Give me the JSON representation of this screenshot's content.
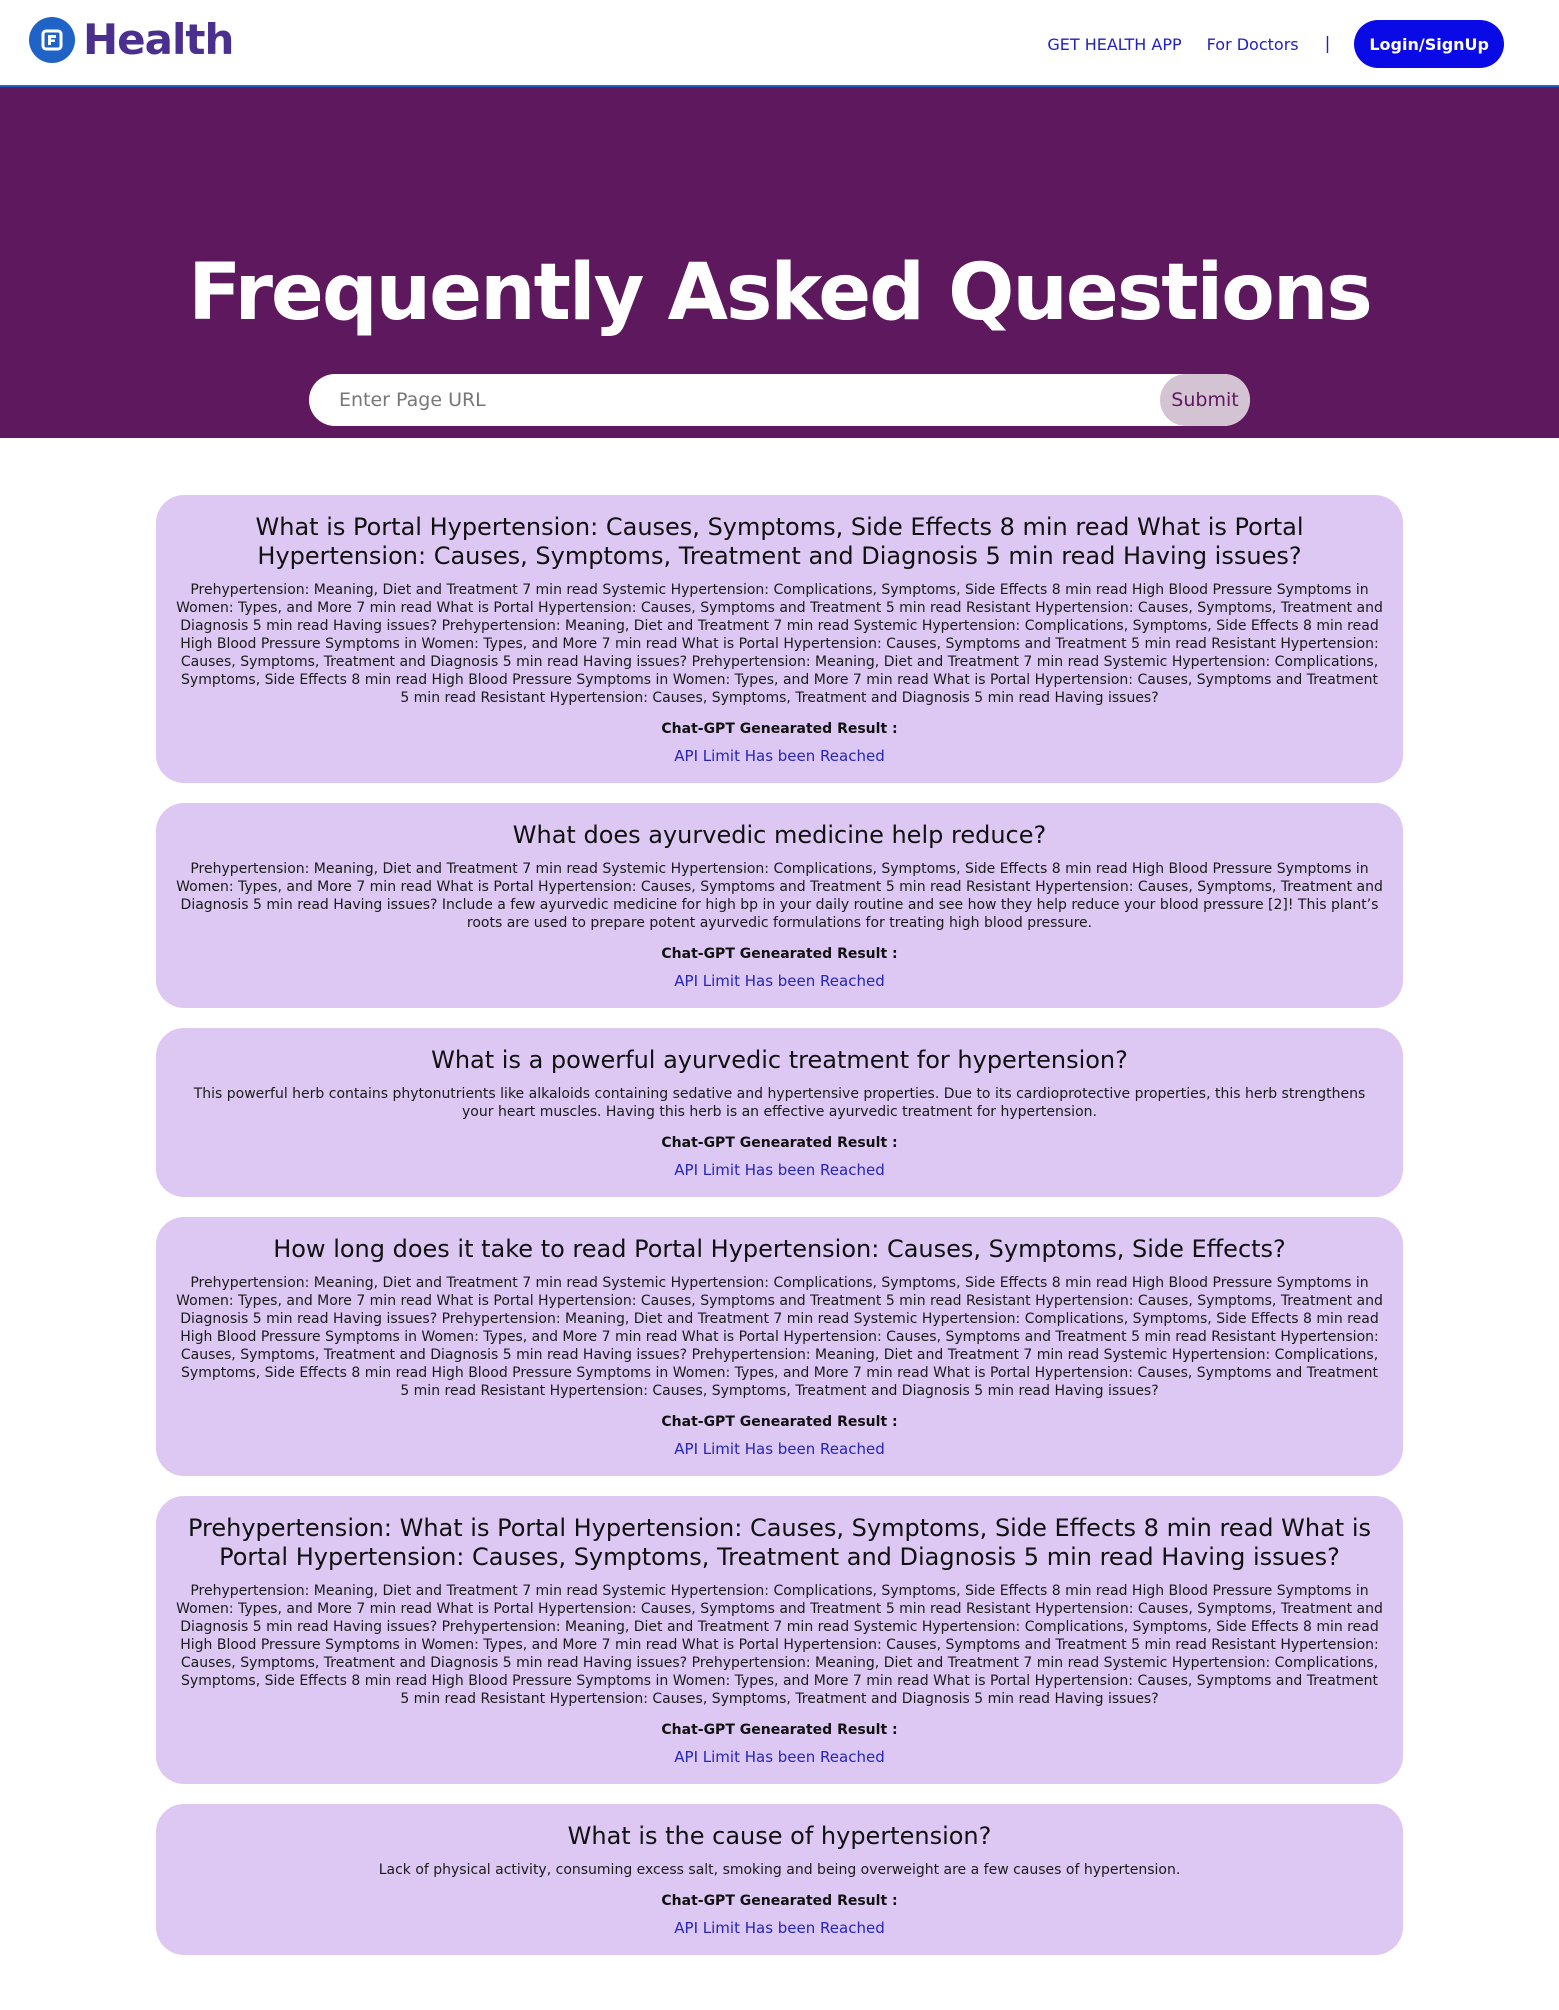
{
  "header": {
    "brand_text": "Health",
    "nav": {
      "get_app": "GET HEALTH APP",
      "for_doctors": "For Doctors",
      "separator": "|",
      "login": "Login/SignUp"
    }
  },
  "hero": {
    "title": "Frequently Asked Questions",
    "search_placeholder": "Enter Page URL",
    "submit_label": "Submit"
  },
  "colors": {
    "hero_bg": "#5e185e",
    "card_bg": "#dcc8f2",
    "login_bg": "#0a0ae6",
    "link": "#2121c2"
  },
  "faqs": [
    {
      "question": "What is Portal Hypertension: Causes, Symptoms, Side Effects 8 min read What is Portal Hypertension: Causes, Symptoms, Treatment and Diagnosis 5 min read Having issues?",
      "answer": "Prehypertension: Meaning, Diet and Treatment 7 min read Systemic Hypertension: Complications, Symptoms, Side Effects 8 min read High Blood Pressure Symptoms in Women: Types, and More 7 min read What is Portal Hypertension: Causes, Symptoms and Treatment 5 min read Resistant Hypertension: Causes, Symptoms, Treatment and Diagnosis 5 min read Having issues? Prehypertension: Meaning, Diet and Treatment 7 min read Systemic Hypertension: Complications, Symptoms, Side Effects 8 min read High Blood Pressure Symptoms in Women: Types, and More 7 min read What is Portal Hypertension: Causes, Symptoms and Treatment 5 min read Resistant Hypertension: Causes, Symptoms, Treatment and Diagnosis 5 min read Having issues? Prehypertension: Meaning, Diet and Treatment 7 min read Systemic Hypertension: Complications, Symptoms, Side Effects 8 min read High Blood Pressure Symptoms in Women: Types, and More 7 min read What is Portal Hypertension: Causes, Symptoms and Treatment 5 min read Resistant Hypertension: Causes, Symptoms, Treatment and Diagnosis 5 min read Having issues?",
      "gpt_label": "Chat-GPT Genearated Result :",
      "gpt_result": "API Limit Has been Reached"
    },
    {
      "question": "What does ayurvedic medicine help reduce?",
      "answer": "Prehypertension: Meaning, Diet and Treatment 7 min read Systemic Hypertension: Complications, Symptoms, Side Effects 8 min read High Blood Pressure Symptoms in Women: Types, and More 7 min read What is Portal Hypertension: Causes, Symptoms and Treatment 5 min read Resistant Hypertension: Causes, Symptoms, Treatment and Diagnosis 5 min read Having issues? Include a few ayurvedic medicine for high bp in your daily routine and see how they help reduce your blood pressure [2]! This plant’s roots are used to prepare potent ayurvedic formulations for treating high blood pressure.",
      "gpt_label": "Chat-GPT Genearated Result :",
      "gpt_result": "API Limit Has been Reached"
    },
    {
      "question": "What is a powerful ayurvedic treatment for hypertension?",
      "answer": "This powerful herb contains phytonutrients like alkaloids containing sedative and hypertensive properties. Due to its cardioprotective properties, this herb strengthens your heart muscles. Having this herb is an effective ayurvedic treatment for hypertension.",
      "gpt_label": "Chat-GPT Genearated Result :",
      "gpt_result": "API Limit Has been Reached"
    },
    {
      "question": "How long does it take to read Portal Hypertension: Causes, Symptoms, Side Effects?",
      "answer": "Prehypertension: Meaning, Diet and Treatment 7 min read Systemic Hypertension: Complications, Symptoms, Side Effects 8 min read High Blood Pressure Symptoms in Women: Types, and More 7 min read What is Portal Hypertension: Causes, Symptoms and Treatment 5 min read Resistant Hypertension: Causes, Symptoms, Treatment and Diagnosis 5 min read Having issues? Prehypertension: Meaning, Diet and Treatment 7 min read Systemic Hypertension: Complications, Symptoms, Side Effects 8 min read High Blood Pressure Symptoms in Women: Types, and More 7 min read What is Portal Hypertension: Causes, Symptoms and Treatment 5 min read Resistant Hypertension: Causes, Symptoms, Treatment and Diagnosis 5 min read Having issues? Prehypertension: Meaning, Diet and Treatment 7 min read Systemic Hypertension: Complications, Symptoms, Side Effects 8 min read High Blood Pressure Symptoms in Women: Types, and More 7 min read What is Portal Hypertension: Causes, Symptoms and Treatment 5 min read Resistant Hypertension: Causes, Symptoms, Treatment and Diagnosis 5 min read Having issues?",
      "gpt_label": "Chat-GPT Genearated Result :",
      "gpt_result": "API Limit Has been Reached"
    },
    {
      "question": "Prehypertension: What is Portal Hypertension: Causes, Symptoms, Side Effects 8 min read What is Portal Hypertension: Causes, Symptoms, Treatment and Diagnosis 5 min read Having issues?",
      "answer": "Prehypertension: Meaning, Diet and Treatment 7 min read Systemic Hypertension: Complications, Symptoms, Side Effects 8 min read High Blood Pressure Symptoms in Women: Types, and More 7 min read What is Portal Hypertension: Causes, Symptoms and Treatment 5 min read Resistant Hypertension: Causes, Symptoms, Treatment and Diagnosis 5 min read Having issues? Prehypertension: Meaning, Diet and Treatment 7 min read Systemic Hypertension: Complications, Symptoms, Side Effects 8 min read High Blood Pressure Symptoms in Women: Types, and More 7 min read What is Portal Hypertension: Causes, Symptoms and Treatment 5 min read Resistant Hypertension: Causes, Symptoms, Treatment and Diagnosis 5 min read Having issues? Prehypertension: Meaning, Diet and Treatment 7 min read Systemic Hypertension: Complications, Symptoms, Side Effects 8 min read High Blood Pressure Symptoms in Women: Types, and More 7 min read What is Portal Hypertension: Causes, Symptoms and Treatment 5 min read Resistant Hypertension: Causes, Symptoms, Treatment and Diagnosis 5 min read Having issues?",
      "gpt_label": "Chat-GPT Genearated Result :",
      "gpt_result": "API Limit Has been Reached"
    },
    {
      "question": "What is the cause of hypertension?",
      "answer": "Lack of physical activity, consuming excess salt, smoking and being overweight are a few causes of hypertension.",
      "gpt_label": "Chat-GPT Genearated Result :",
      "gpt_result": "API Limit Has been Reached"
    }
  ]
}
